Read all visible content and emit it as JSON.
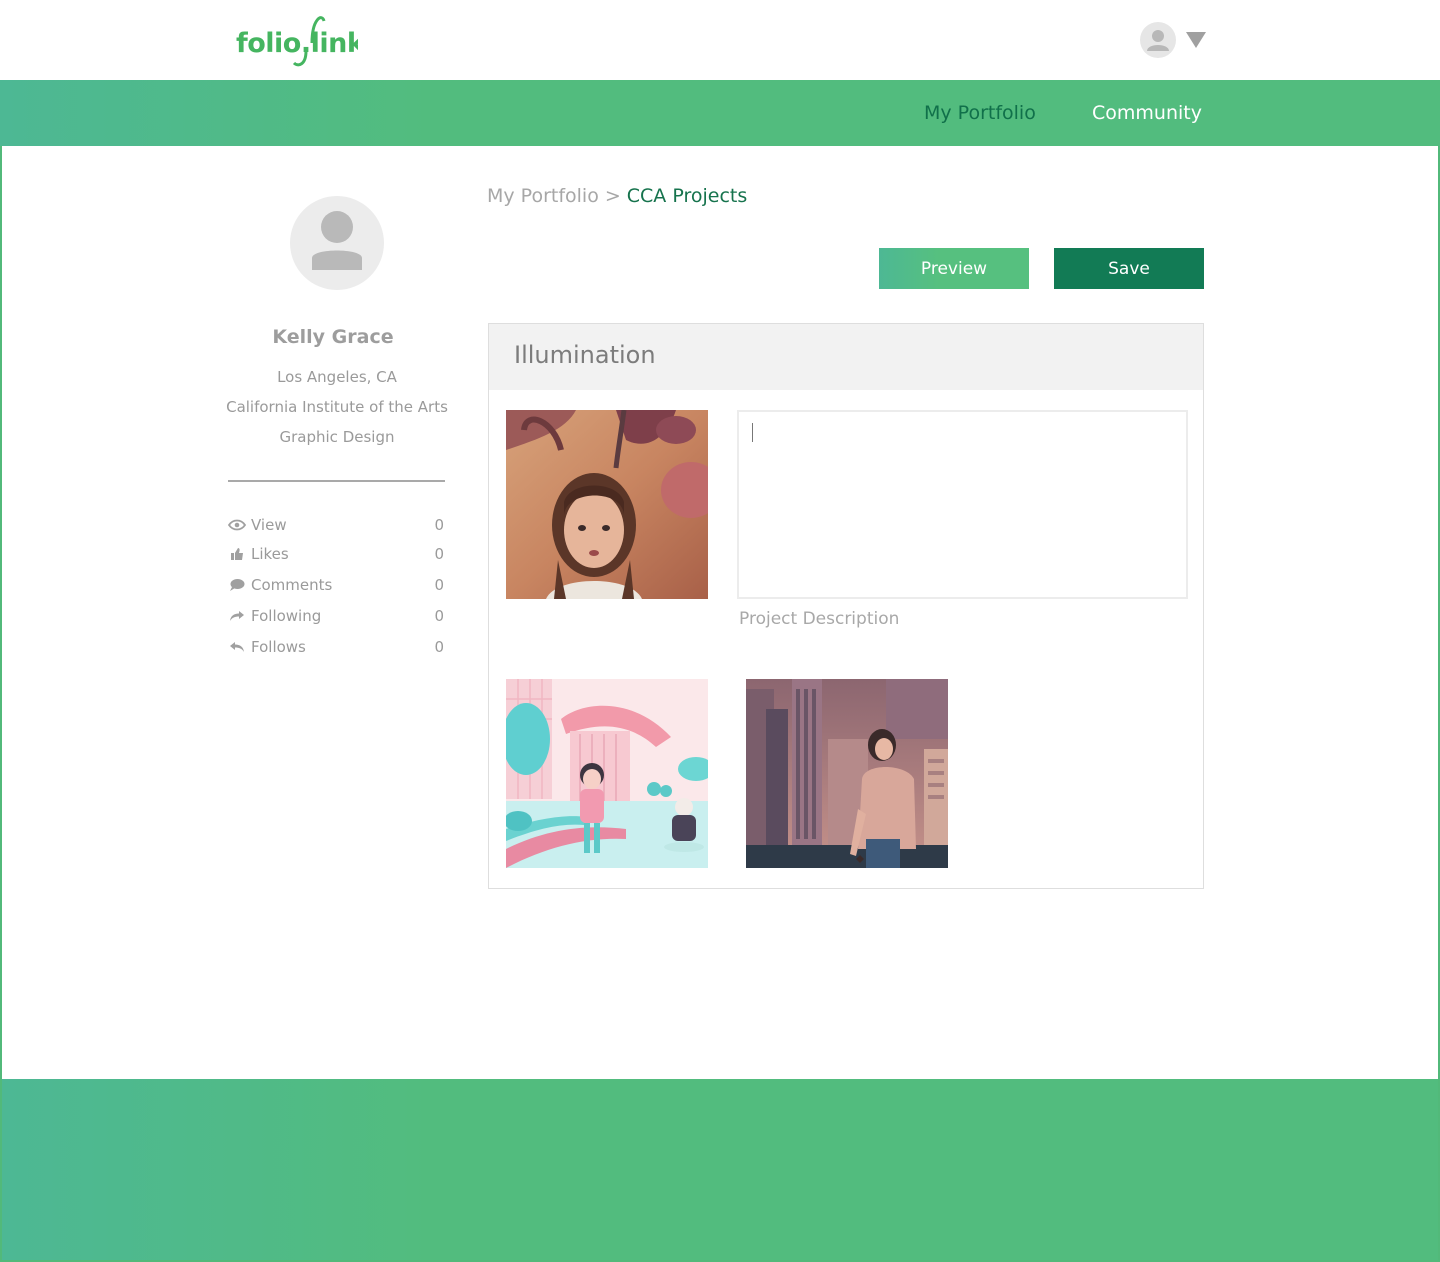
{
  "brand": {
    "logo_text": "folio.link",
    "accent": "#52bc7e",
    "accent_dark": "#127b55"
  },
  "header": {
    "user_avatar_icon": "user-avatar-icon",
    "menu_icon": "caret-down-icon"
  },
  "nav": {
    "items": [
      {
        "label": "My Portfolio",
        "active": true
      },
      {
        "label": "Community",
        "active": false
      }
    ]
  },
  "profile": {
    "name": "Kelly Grace",
    "location": "Los Angeles, CA",
    "school": "California Institute of the Arts",
    "major": "Graphic Design",
    "stats": [
      {
        "icon": "eye-icon",
        "label": "View",
        "value": "0"
      },
      {
        "icon": "thumbs-up-icon",
        "label": "Likes",
        "value": "0"
      },
      {
        "icon": "comment-icon",
        "label": "Comments",
        "value": "0"
      },
      {
        "icon": "share-icon",
        "label": "Following",
        "value": "0"
      },
      {
        "icon": "reply-icon",
        "label": "Follows",
        "value": "0"
      }
    ]
  },
  "breadcrumb": {
    "parent": "My Portfolio",
    "separator": ">",
    "current": "CCA Projects"
  },
  "actions": {
    "preview_label": "Preview",
    "save_label": "Save"
  },
  "project": {
    "title": "Illumination",
    "description_value": "",
    "description_label": "Project Description",
    "images": [
      {
        "name": "portrait-illustration"
      },
      {
        "name": "city-park-illustration"
      },
      {
        "name": "city-skyline-illustration"
      }
    ]
  }
}
